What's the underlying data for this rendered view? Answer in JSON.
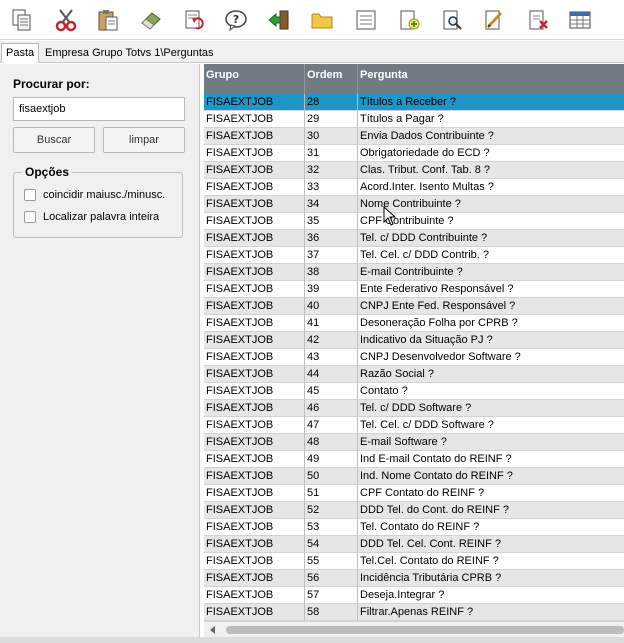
{
  "toolbar": {
    "icons": [
      "copy-icon",
      "cut-icon",
      "paste-icon",
      "eraser-icon",
      "undo-icon",
      "help-icon",
      "exit-icon",
      "folder-icon",
      "list-icon",
      "new-icon",
      "view-icon",
      "edit-icon",
      "delete-icon",
      "grid-icon"
    ]
  },
  "tabs": [
    {
      "label": "Pasta",
      "active": true
    },
    {
      "label": "Empresa Grupo Totvs 1\\Perguntas",
      "active": false
    }
  ],
  "search": {
    "label": "Procurar por:",
    "value": "fisaextjob",
    "buscar_label": "Buscar",
    "limpar_label": "limpar"
  },
  "options": {
    "title": "Opções",
    "items": [
      {
        "label": "coincidir maiusc./minusc.",
        "checked": false
      },
      {
        "label": "Localizar palavra inteira",
        "checked": false
      }
    ]
  },
  "grid": {
    "columns": [
      "Grupo",
      "Ordem",
      "Pergunta"
    ],
    "selected_index": 0,
    "rows": [
      [
        "FISAEXTJOB",
        "28",
        "Títulos a Receber ?"
      ],
      [
        "FISAEXTJOB",
        "29",
        "Títulos a Pagar ?"
      ],
      [
        "FISAEXTJOB",
        "30",
        "Envia Dados Contribuinte ?"
      ],
      [
        "FISAEXTJOB",
        "31",
        "Obrigatoriedade do ECD ?"
      ],
      [
        "FISAEXTJOB",
        "32",
        "Clas. Tribut. Conf. Tab. 8 ?"
      ],
      [
        "FISAEXTJOB",
        "33",
        "Acord.Inter. Isento Multas ?"
      ],
      [
        "FISAEXTJOB",
        "34",
        "Nome Contribuinte ?"
      ],
      [
        "FISAEXTJOB",
        "35",
        "CPF Contribuinte ?"
      ],
      [
        "FISAEXTJOB",
        "36",
        "Tel. c/ DDD Contribuinte ?"
      ],
      [
        "FISAEXTJOB",
        "37",
        "Tel. Cel. c/ DDD Contrib. ?"
      ],
      [
        "FISAEXTJOB",
        "38",
        "E-mail Contribuinte ?"
      ],
      [
        "FISAEXTJOB",
        "39",
        "Ente Federativo Responsável ?"
      ],
      [
        "FISAEXTJOB",
        "40",
        "CNPJ Ente Fed. Responsável ?"
      ],
      [
        "FISAEXTJOB",
        "41",
        "Desoneração Folha por CPRB ?"
      ],
      [
        "FISAEXTJOB",
        "42",
        "Indicativo da Situação PJ ?"
      ],
      [
        "FISAEXTJOB",
        "43",
        "CNPJ Desenvolvedor Software ?"
      ],
      [
        "FISAEXTJOB",
        "44",
        "Razão Social ?"
      ],
      [
        "FISAEXTJOB",
        "45",
        "Contato ?"
      ],
      [
        "FISAEXTJOB",
        "46",
        "Tel. c/ DDD Software ?"
      ],
      [
        "FISAEXTJOB",
        "47",
        "Tel. Cel. c/ DDD Software ?"
      ],
      [
        "FISAEXTJOB",
        "48",
        "E-mail Software ?"
      ],
      [
        "FISAEXTJOB",
        "49",
        "Ind E-mail Contato do REINF ?"
      ],
      [
        "FISAEXTJOB",
        "50",
        "Ind. Nome Contato do REINF ?"
      ],
      [
        "FISAEXTJOB",
        "51",
        "CPF Contato do REINF ?"
      ],
      [
        "FISAEXTJOB",
        "52",
        "DDD Tel. do Cont. do REINF ?"
      ],
      [
        "FISAEXTJOB",
        "53",
        "Tel. Contato do REINF ?"
      ],
      [
        "FISAEXTJOB",
        "54",
        "DDD Tel. Cel. Cont.  REINF ?"
      ],
      [
        "FISAEXTJOB",
        "55",
        "Tel.Cel. Contato do REINF ?"
      ],
      [
        "FISAEXTJOB",
        "56",
        "Incidência Tributária CPRB ?"
      ],
      [
        "FISAEXTJOB",
        "57",
        "Deseja.Integrar ?"
      ],
      [
        "FISAEXTJOB",
        "58",
        "Filtrar.Apenas REINF ?"
      ]
    ]
  }
}
